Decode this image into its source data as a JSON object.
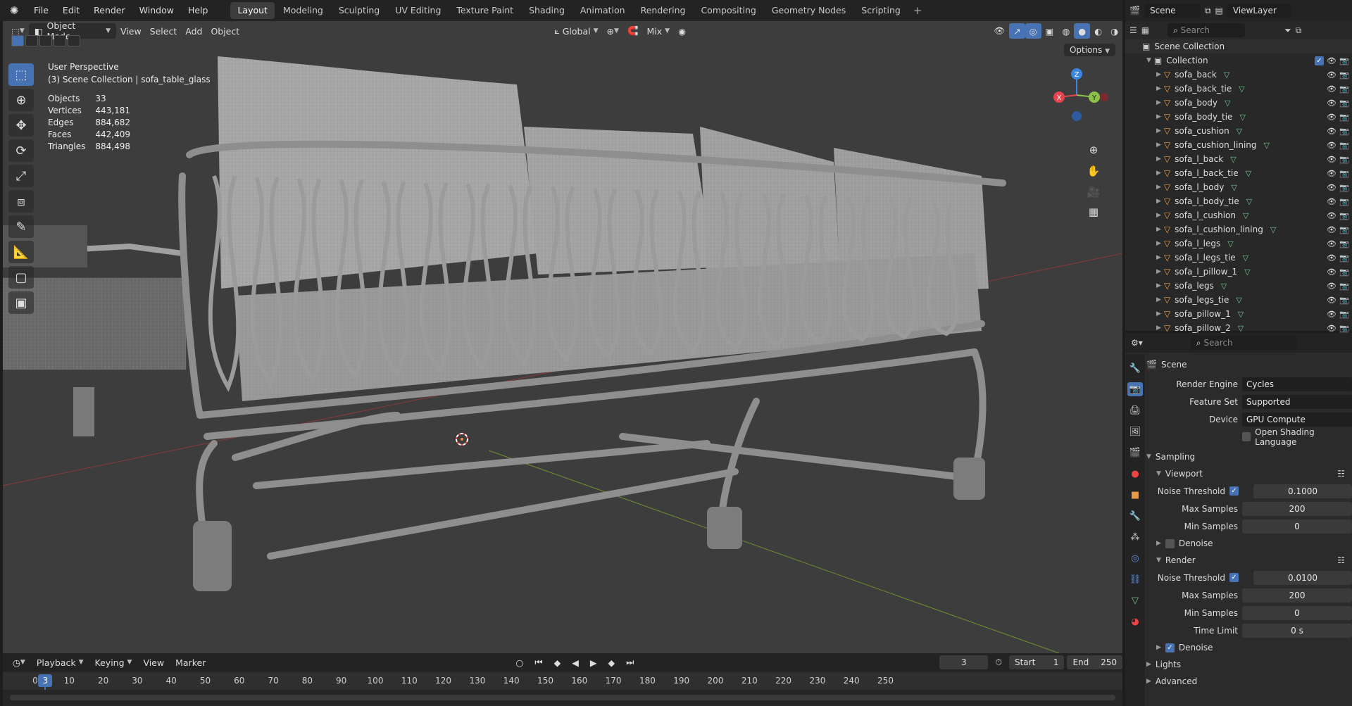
{
  "menu": {
    "file": "File",
    "edit": "Edit",
    "render": "Render",
    "window": "Window",
    "help": "Help"
  },
  "workspaces": [
    "Layout",
    "Modeling",
    "Sculpting",
    "UV Editing",
    "Texture Paint",
    "Shading",
    "Animation",
    "Rendering",
    "Compositing",
    "Geometry Nodes",
    "Scripting"
  ],
  "scene_selector": "Scene",
  "view_layer": "ViewLayer",
  "viewport": {
    "mode": "Object Mode",
    "view": "View",
    "select": "Select",
    "add": "Add",
    "object": "Object",
    "orientation": "Global",
    "snap_mix": "Mix",
    "options": "Options",
    "perspective": "User Perspective",
    "collection_info": "(3) Scene Collection | sofa_table_glass",
    "stats": [
      {
        "label": "Objects",
        "value": "33"
      },
      {
        "label": "Vertices",
        "value": "443,181"
      },
      {
        "label": "Edges",
        "value": "884,682"
      },
      {
        "label": "Faces",
        "value": "442,409"
      },
      {
        "label": "Triangles",
        "value": "884,498"
      }
    ],
    "gizmo": {
      "x": "X",
      "y": "Y",
      "z": "Z"
    }
  },
  "timeline": {
    "playback": "Playback",
    "keying": "Keying",
    "view": "View",
    "marker": "Marker",
    "current": "3",
    "start_label": "Start",
    "start": "1",
    "end_label": "End",
    "end": "250",
    "ticks": [
      "0",
      "10",
      "20",
      "30",
      "40",
      "50",
      "60",
      "70",
      "80",
      "90",
      "100",
      "110",
      "120",
      "130",
      "140",
      "150",
      "160",
      "170",
      "180",
      "190",
      "200",
      "210",
      "220",
      "230",
      "240",
      "250"
    ],
    "playhead": "3"
  },
  "outliner": {
    "search_placeholder": "Search",
    "scene_collection": "Scene Collection",
    "collection": "Collection",
    "items": [
      "sofa_back",
      "sofa_back_tie",
      "sofa_body",
      "sofa_body_tie",
      "sofa_cushion",
      "sofa_cushion_lining",
      "sofa_l_back",
      "sofa_l_back_tie",
      "sofa_l_body",
      "sofa_l_body_tie",
      "sofa_l_cushion",
      "sofa_l_cushion_lining",
      "sofa_l_legs",
      "sofa_l_legs_tie",
      "sofa_l_pillow_1",
      "sofa_legs",
      "sofa_legs_tie",
      "sofa_pillow_1",
      "sofa_pillow_2"
    ]
  },
  "properties": {
    "search_placeholder": "Search",
    "scene": "Scene",
    "render_engine_label": "Render Engine",
    "render_engine": "Cycles",
    "feature_set_label": "Feature Set",
    "feature_set": "Supported",
    "device_label": "Device",
    "device": "GPU Compute",
    "osl": "Open Shading Language",
    "sampling": "Sampling",
    "viewport": "Viewport",
    "noise_threshold_label": "Noise Threshold",
    "vp_noise": "0.1000",
    "max_samples_label": "Max Samples",
    "vp_max": "200",
    "min_samples_label": "Min Samples",
    "vp_min": "0",
    "denoise": "Denoise",
    "render": "Render",
    "r_noise": "0.0100",
    "r_max": "200",
    "r_min": "0",
    "time_limit_label": "Time Limit",
    "r_time": "0 s",
    "r_denoise": "Denoise",
    "lights": "Lights",
    "advanced": "Advanced"
  },
  "colors": {
    "accent": "#4772b3",
    "mesh_icon": "#73c48f",
    "object_icon": "#e89a45",
    "axis_x": "#e8444f",
    "axis_y": "#8bc34a",
    "axis_z": "#3b86e0"
  }
}
